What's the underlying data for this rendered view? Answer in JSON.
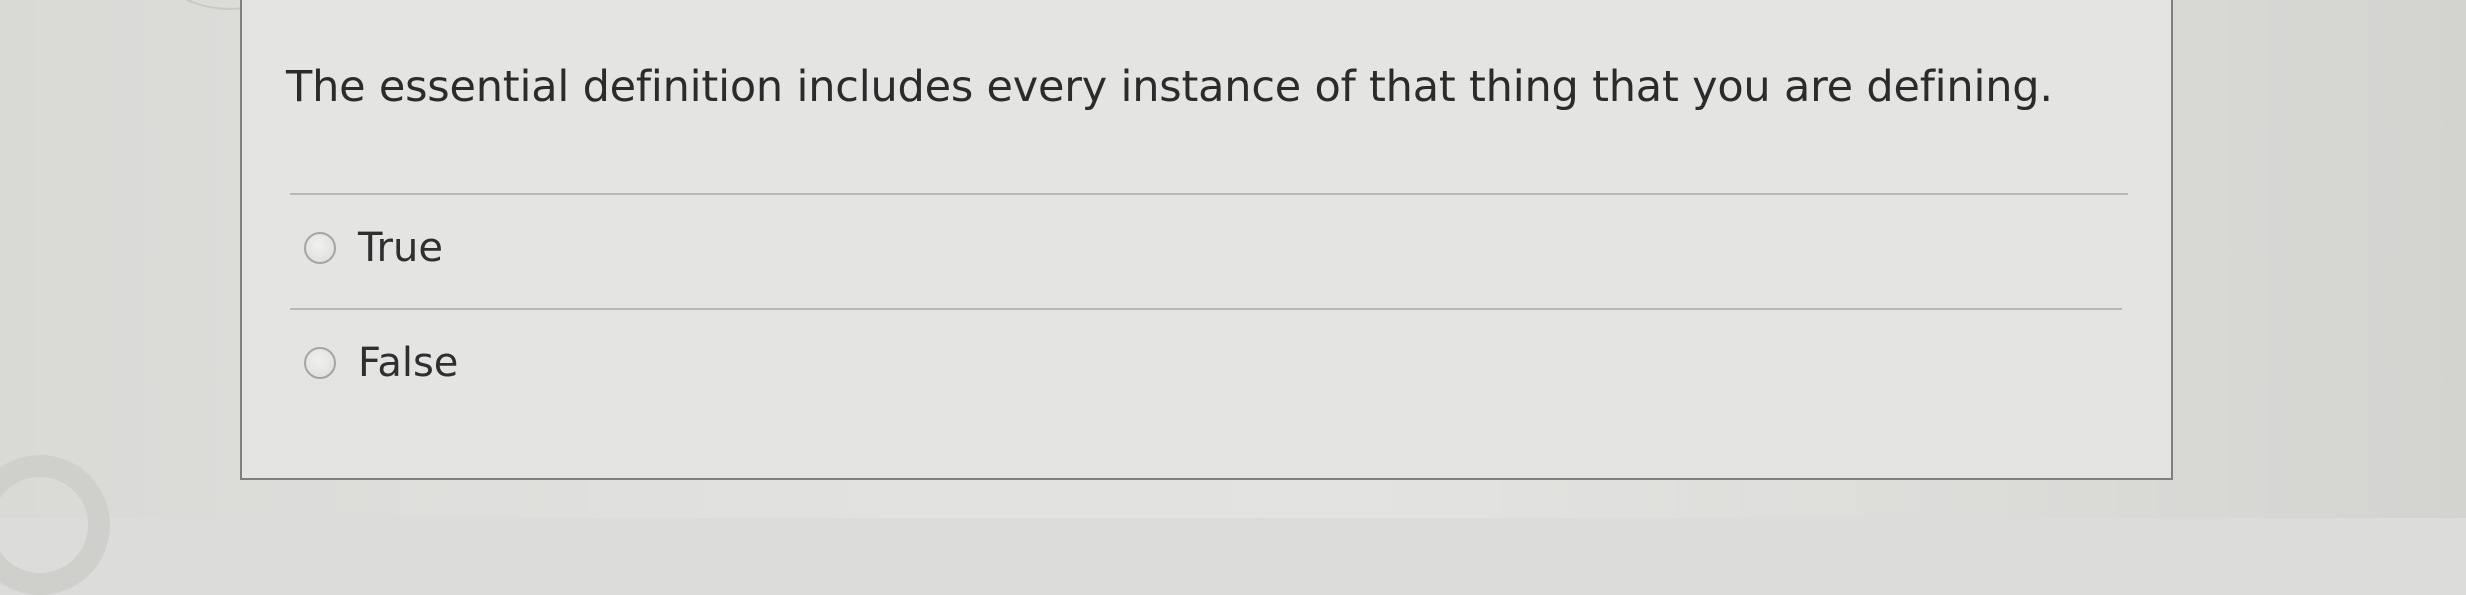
{
  "question": {
    "text": "The essential definition includes every instance of that thing that you are defining."
  },
  "options": [
    {
      "label": "True",
      "selected": false
    },
    {
      "label": "False",
      "selected": false
    }
  ]
}
